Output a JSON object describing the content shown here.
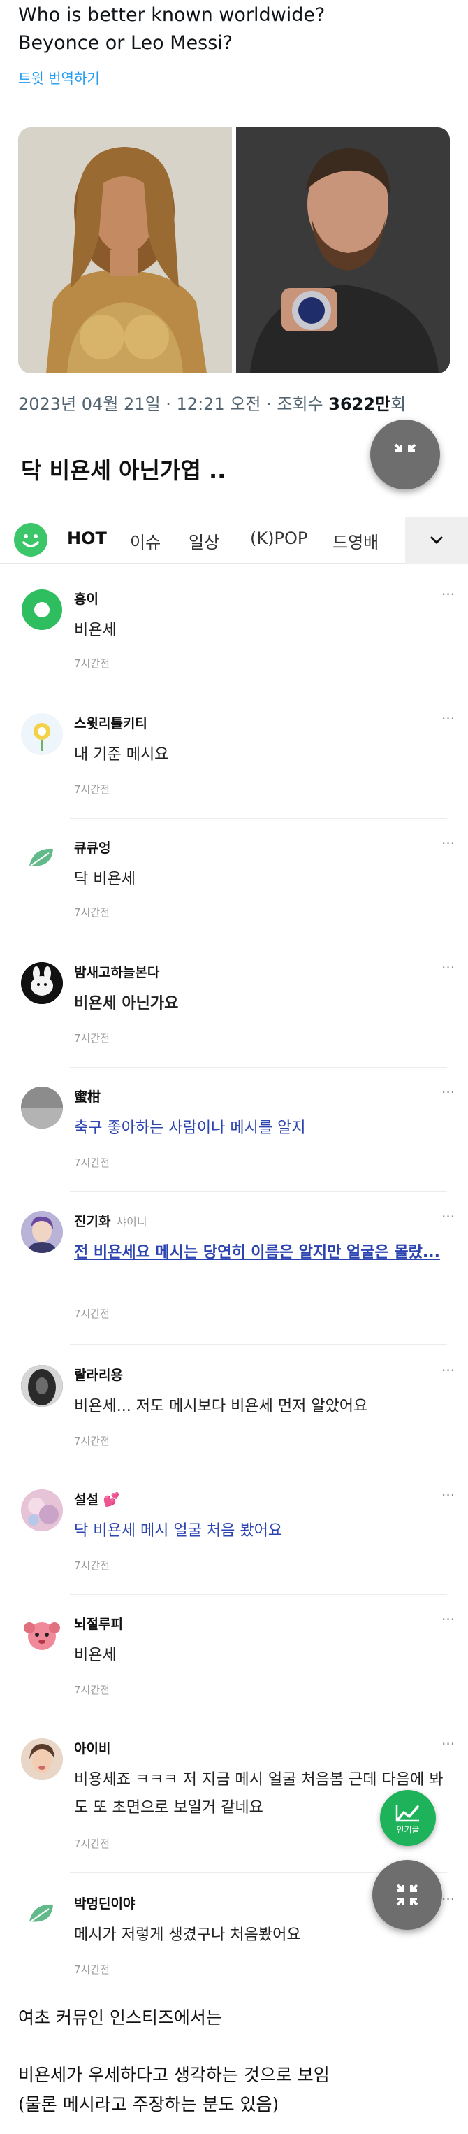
{
  "tweet": {
    "text_line1": "Who is better known worldwide?",
    "text_line2": "Beyonce or Leo Messi?",
    "translate": "트윗 번역하기",
    "meta": "2023년 04월 21일 · 12:21 오전 · 조회수 ",
    "views": "3622만",
    "views_suffix": "회"
  },
  "post": {
    "title": "닥 비욘세 아닌가엽 .."
  },
  "tabs": [
    "HOT",
    "이슈",
    "일상",
    "(K)POP",
    "드영배"
  ],
  "comments": [
    {
      "name": "흥이",
      "text": "비욘세",
      "time": "7시간전"
    },
    {
      "name": "스윗리틀키티",
      "text": "내 기준 메시요",
      "time": "7시간전"
    },
    {
      "name": "큐큐엉",
      "text": "닥 비욘세",
      "time": "7시간전"
    },
    {
      "name": "밤새고하늘본다",
      "text": "비욘세 아닌가요",
      "time": "7시간전"
    },
    {
      "name": "蜜柑",
      "text": "축구 좋아하는 사람이나 메시를 알지",
      "time": "7시간전"
    },
    {
      "name": "진기화",
      "badge": "샤이니",
      "text": "전 비욘세요 메시는 당연히 이름은 알지만 얼굴은 몰랐...",
      "time": "7시간전"
    },
    {
      "name": "랄라리용",
      "text": "비욘세... 저도 메시보다 비욘세 먼저 알았어요",
      "time": "7시간전"
    },
    {
      "name": "설설 💕",
      "text": "닥 비욘세 메시 얼굴 처음 봤어요",
      "time": "7시간전"
    },
    {
      "name": "뇌절루피",
      "text": "비욘세",
      "time": "7시간전"
    },
    {
      "name": "아이비",
      "text": "비용세죠 ㅋㅋㅋ 저 지금 메시 얼굴 처음봄 근데 다음에 봐도 또 초면으로 보일거 같네요",
      "time": "7시간전"
    },
    {
      "name": "박멍딘이야",
      "text": "메시가 저렇게 생겼구나 처음봤어요",
      "time": "7시간전"
    }
  ],
  "popular_label": "인기글",
  "footer": {
    "line1": "여초 커뮤인 인스티즈에서는",
    "line2": "비욘세가 우세하다고 생각하는 것으로 보임",
    "line3": "(물론 메시라고 주장하는 분도 있음)"
  },
  "colors": {
    "link_blue": "#1d9bf0",
    "comment_blue": "#2c44b0",
    "brand_green": "#3cc66a"
  }
}
